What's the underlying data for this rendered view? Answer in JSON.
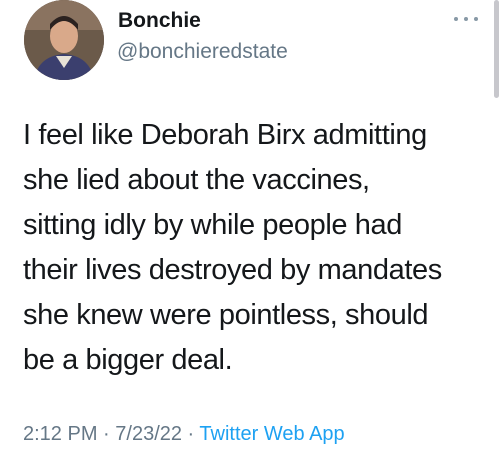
{
  "author": {
    "display_name": "Bonchie",
    "handle": "@bonchieredstate"
  },
  "tweet": {
    "text": "I feel like Deborah Birx admitting\nshe lied about the vaccines,\nsitting idly by while people had\ntheir lives destroyed by mandates\nshe knew were pointless, should\nbe a bigger deal.",
    "time": "2:12 PM",
    "date": "7/23/22",
    "separator": " · ",
    "source": "Twitter Web App"
  },
  "icons": {
    "more": "more-horizontal-icon"
  },
  "colors": {
    "text": "#14171a",
    "secondary": "#657786",
    "link": "#1da1f2"
  }
}
